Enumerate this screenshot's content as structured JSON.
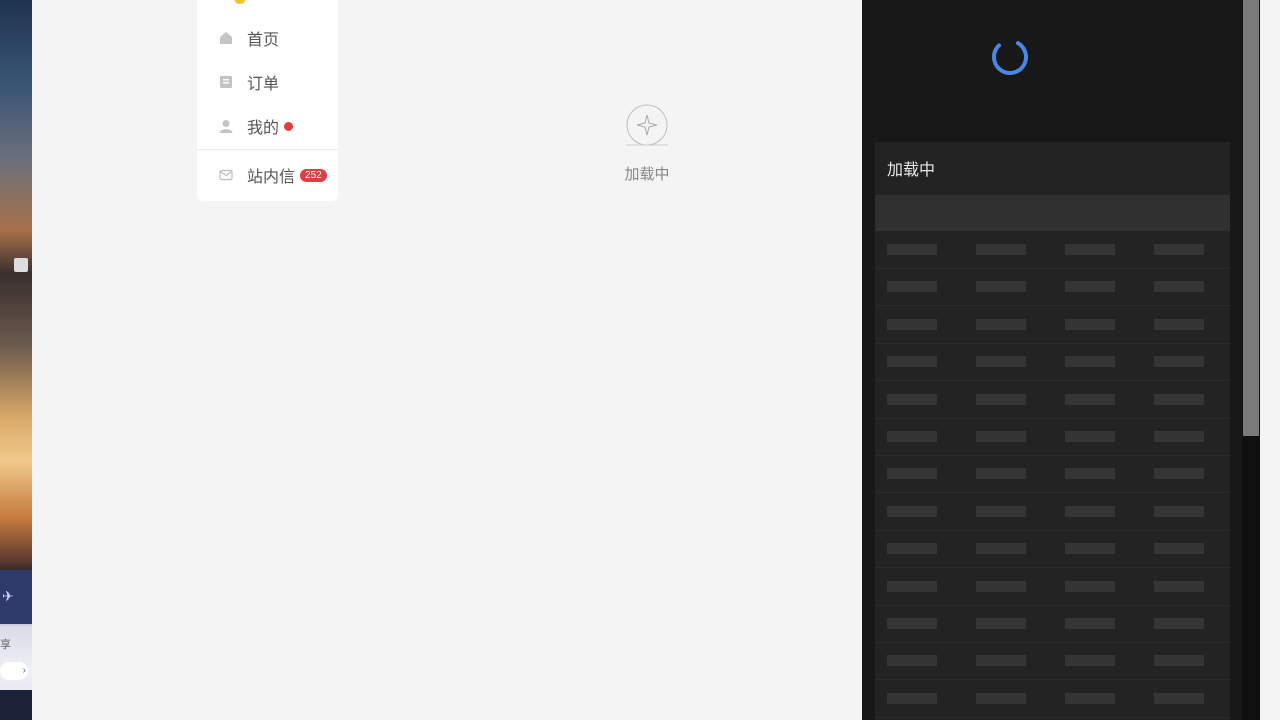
{
  "sidebar_menu": {
    "items": [
      {
        "label": "首页",
        "icon": "home-icon"
      },
      {
        "label": "订单",
        "icon": "order-icon"
      },
      {
        "label": "我的",
        "icon": "user-icon",
        "has_dot": true
      },
      {
        "label": "站内信",
        "icon": "mail-icon",
        "badge": "252"
      }
    ]
  },
  "main": {
    "loading_label": "加载中"
  },
  "panel": {
    "card_title": "加载中",
    "skeleton_rows": 13,
    "skeleton_columns": 4
  },
  "desktop": {
    "share_label": "享"
  },
  "colors": {
    "badge": "#e23c44",
    "spinner": "#4a86e8",
    "panel_bg": "#181818"
  }
}
